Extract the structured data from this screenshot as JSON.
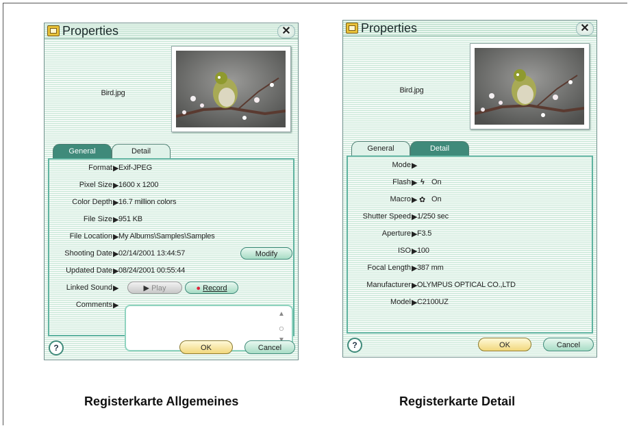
{
  "left_dialog": {
    "title": "Properties",
    "filename": "Bird.jpg",
    "tabs": [
      "General",
      "Detail"
    ],
    "active_tab": "General",
    "rows": [
      {
        "label": "Format",
        "value": "Exif-JPEG"
      },
      {
        "label": "Pixel Size",
        "value": "1600 x 1200"
      },
      {
        "label": "Color Depth",
        "value": "16.7 million colors"
      },
      {
        "label": "File Size",
        "value": "951 KB"
      },
      {
        "label": "File Location",
        "value": "My Albums\\Samples\\Samples"
      },
      {
        "label": "Shooting Date",
        "value": "02/14/2001 13:44:57"
      },
      {
        "label": "Updated Date",
        "value": "08/24/2001 00:55:44"
      },
      {
        "label": "Linked Sound",
        "value": ""
      },
      {
        "label": "Comments",
        "value": ""
      }
    ],
    "modify_label": "Modify",
    "play_label": "Play",
    "record_label": "Record",
    "help_label": "?",
    "ok_label": "OK",
    "cancel_label": "Cancel",
    "caption": "Registerkarte Allgemeines"
  },
  "right_dialog": {
    "title": "Properties",
    "filename": "Bird.jpg",
    "tabs": [
      "General",
      "Detail"
    ],
    "active_tab": "Detail",
    "rows": [
      {
        "label": "Mode",
        "value": ""
      },
      {
        "label": "Flash",
        "value": "On",
        "icon": "flash-icon"
      },
      {
        "label": "Macro",
        "value": "On",
        "icon": "macro-flower-icon"
      },
      {
        "label": "Shutter Speed",
        "value": "1/250 sec"
      },
      {
        "label": "Aperture",
        "value": "F3.5"
      },
      {
        "label": "ISO",
        "value": "100"
      },
      {
        "label": "Focal Length",
        "value": "387 mm"
      },
      {
        "label": "Manufacturer",
        "value": "OLYMPUS OPTICAL CO.,LTD"
      },
      {
        "label": "Model",
        "value": "C2100UZ"
      }
    ],
    "help_label": "?",
    "ok_label": "OK",
    "cancel_label": "Cancel",
    "caption": "Registerkarte Detail"
  },
  "colors": {
    "tab_active": "#3f8a7a",
    "record_dot": "#e0223a",
    "panel_border": "#5fb3a0"
  }
}
